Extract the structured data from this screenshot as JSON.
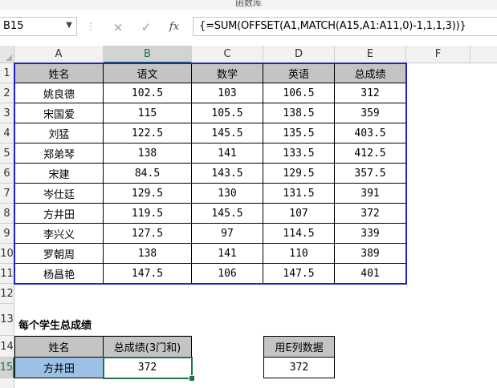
{
  "window": {
    "title": "函数库"
  },
  "formula_bar": {
    "name_box": "B15",
    "cancel_icon": "×",
    "confirm_icon": "✓",
    "fx_label": "fx",
    "formula": "{=SUM(OFFSET(A1,MATCH(A15,A1:A11,0)-1,1,1,3))}"
  },
  "columns": [
    "A",
    "B",
    "C",
    "D",
    "E",
    "F"
  ],
  "rows": [
    "1",
    "2",
    "3",
    "4",
    "5",
    "6",
    "7",
    "8",
    "9",
    "10",
    "11",
    "12",
    "13",
    "14",
    "15"
  ],
  "table": {
    "headers": [
      "姓名",
      "语文",
      "数学",
      "英语",
      "总成绩"
    ],
    "rows": [
      [
        "姚良德",
        "102.5",
        "103",
        "106.5",
        "312"
      ],
      [
        "宋国爱",
        "115",
        "105.5",
        "138.5",
        "359"
      ],
      [
        "刘猛",
        "122.5",
        "145.5",
        "135.5",
        "403.5"
      ],
      [
        "郑弟琴",
        "138",
        "141",
        "133.5",
        "412.5"
      ],
      [
        "宋建",
        "84.5",
        "143.5",
        "129.5",
        "357.5"
      ],
      [
        "岑仕廷",
        "129.5",
        "130",
        "131.5",
        "391"
      ],
      [
        "方井田",
        "119.5",
        "145.5",
        "107",
        "372"
      ],
      [
        "李兴义",
        "127.5",
        "97",
        "114.5",
        "339"
      ],
      [
        "罗朝周",
        "138",
        "141",
        "110",
        "389"
      ],
      [
        "杨昌艳",
        "147.5",
        "106",
        "147.5",
        "401"
      ]
    ]
  },
  "lookup": {
    "section_title": "每个学生总成绩",
    "name_header": "姓名",
    "total_header": "总成绩(3门和)",
    "name_value": "方井田",
    "total_value": "372",
    "alt_header": "用E列数据",
    "alt_value": "372"
  },
  "colors": {
    "header_fill": "#c4c4c4",
    "lookup_name_fill": "#9bc2e6",
    "table_outline": "#1f1fcf",
    "selection": "#217346"
  }
}
